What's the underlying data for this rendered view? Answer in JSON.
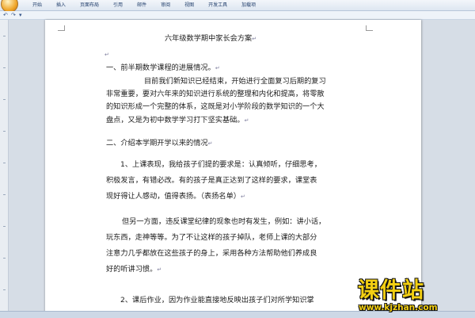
{
  "ribbon": {
    "tabs": [
      "开始",
      "插入",
      "页面布局",
      "引用",
      "邮件",
      "审阅",
      "视图",
      "开发工具",
      "加载项"
    ]
  },
  "quick_access": {
    "undo": "↶",
    "redo": "↷",
    "dropdown": "▾"
  },
  "document": {
    "paragraph_mark": "↵",
    "title": "六年级数学期中家长会方案",
    "section1": "一、前半期数学课程的进展情况。",
    "p1_line1": "目前我们新知识已经结束，开始进行全面复习后期的复习",
    "p1_line2": "非常重要，要对六年来的知识进行系统的整理和内化和提高，将零散",
    "p1_line3": "的知识形成一个完整的体系，这既是对小学阶段的数学知识的一个大",
    "p1_line4": "盘点，又是为初中数学学习打下坚实基础。",
    "section2": "二、介绍本学期开学以来的情况",
    "p2_line1": "1、上课表现，我给孩子们提的要求是：认真倾听，仔细思考，",
    "p2_line2": "积极发言，有错必改。有的孩子是真正达到了这样的要求，课堂表",
    "p2_line3": "现好得让人感动，值得表扬。（表扬名单）",
    "p3_line1": "但另一方面，违反课堂纪律的现象也时有发生，例如：讲小话，",
    "p3_line2": "玩东西，走神等等。为了不让这样的孩子掉队，老师上课的大部分",
    "p3_line3": "注意力几乎都放在这些孩子的身上，采用各种方法帮助他们养成良",
    "p3_line4": "好的听讲习惯。",
    "p4_line1": "2、课后作业，因为作业能直接地反映出孩子们对所学知识掌"
  },
  "watermark": {
    "title": "课件站",
    "url": "www.kjzhan.com"
  },
  "colors": {
    "watermark_fill": "#f3cf12",
    "ribbon_text": "#23406d"
  }
}
